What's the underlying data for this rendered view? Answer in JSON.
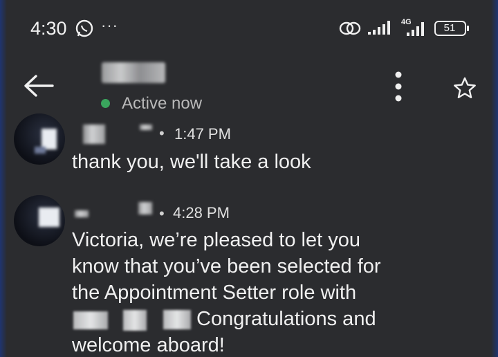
{
  "status_bar": {
    "time": "4:30",
    "network": "4G",
    "battery": "51",
    "icons": [
      "whatsapp-icon",
      "more-icon",
      "link-icon",
      "signal-icon",
      "signal-4g-icon",
      "battery-icon"
    ]
  },
  "header": {
    "presence": "Active now",
    "presence_color": "#3aa55d",
    "icons": [
      "back-arrow-icon",
      "kebab-menu-icon",
      "star-icon"
    ]
  },
  "messages": [
    {
      "separator": "•",
      "time": "1:47 PM",
      "text": "thank you, we'll take a look"
    },
    {
      "separator": "•",
      "time": "4:28 PM",
      "lines": [
        "Victoria,  we’re pleased to let you",
        "know that you’ve been selected for",
        "the Appointment Setter role with",
        "Congratulations and",
        "welcome aboard!"
      ]
    }
  ]
}
